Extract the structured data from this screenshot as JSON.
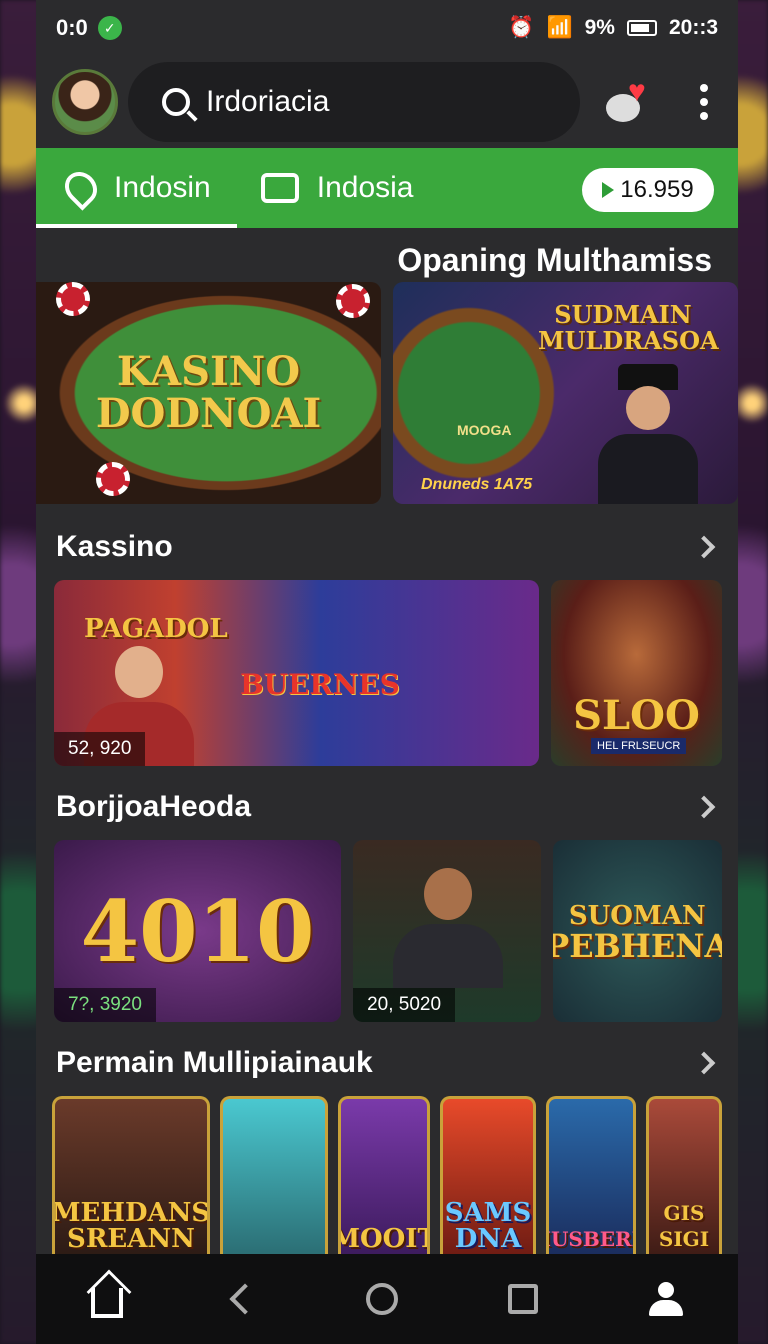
{
  "status_bar": {
    "left_text": "0:0",
    "right_text": "9%",
    "time": "20::3"
  },
  "header": {
    "search_text": "Irdoriacia"
  },
  "tabs": [
    {
      "label": "Indosin",
      "icon": "location-pin-icon",
      "active": true
    },
    {
      "label": "Indosia",
      "icon": "tv-icon",
      "active": false
    }
  ],
  "balance": "16.959",
  "promo": {
    "title": "Opaning Multhamiss",
    "banner_1": {
      "title_line1": "KASINO",
      "title_line2": "DODNOAI"
    },
    "banner_2": {
      "title_line1": "SUDMAIN",
      "title_line2": "MULDRASOA",
      "small_label": "MOOGA",
      "bottom_label": "Dnuneds 1A75"
    }
  },
  "sections": {
    "kassino": {
      "title": "Kassino",
      "cards": [
        {
          "title_top": "PAGADOL",
          "center_title": "BUERNES",
          "count": "52, 920"
        },
        {
          "title": "SLOO",
          "subtitle": "HEL FRLSEUCR"
        }
      ]
    },
    "borjioa": {
      "title": "BorjjoaHeoda",
      "cards": [
        {
          "title": "4010",
          "count": "7?, 3920"
        },
        {
          "count": "20, 5020"
        },
        {
          "title_line1": "SUOMAN",
          "title_line2": "PEBHENA"
        }
      ]
    },
    "multiplayer": {
      "title": "Permain Mullipiainauk",
      "cards": [
        {
          "title": "MEHDANS SREANN"
        },
        {
          "title": ""
        },
        {
          "title": "MOOIT"
        },
        {
          "title": "SAMS DNA"
        },
        {
          "title": "HUSBERN"
        },
        {
          "title": "GIS SIGI"
        }
      ]
    }
  },
  "colors": {
    "accent_green": "#3aa83d",
    "gold": "#f4c542",
    "panel": "#2b2b2d"
  }
}
